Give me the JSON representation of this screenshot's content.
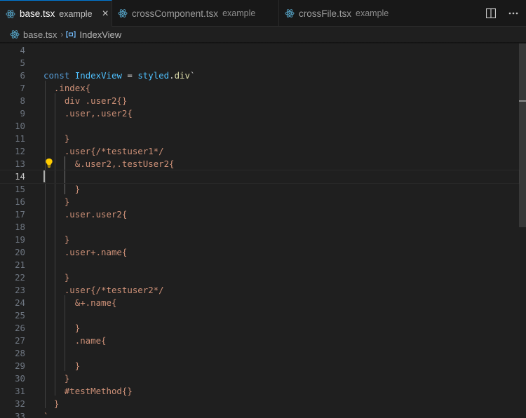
{
  "tabs": [
    {
      "label": "base.tsx",
      "description": "example",
      "active": true
    },
    {
      "label": "crossComponent.tsx",
      "description": "example",
      "active": false
    },
    {
      "label": "crossFile.tsx",
      "description": "example",
      "active": false
    }
  ],
  "breadcrumb": {
    "file": "base.tsx",
    "symbol": "IndexView"
  },
  "colors": {
    "accent": "#0078d4",
    "react_icon": "#519aba",
    "string": "#ce9178",
    "keyword": "#569cd6",
    "variable": "#4fc1ff",
    "bulb": "#ffcc00"
  },
  "editor": {
    "current_line": 14,
    "lines": [
      {
        "num": "4",
        "text": ""
      },
      {
        "num": "5",
        "text": ""
      },
      {
        "num": "6",
        "text": ""
      },
      {
        "num": "7",
        "text": "  .index{"
      },
      {
        "num": "8",
        "text": "    div .user2{}"
      },
      {
        "num": "9",
        "text": "    .user,.user2{"
      },
      {
        "num": "10",
        "text": ""
      },
      {
        "num": "11",
        "text": "    }"
      },
      {
        "num": "12",
        "text": "    .user{/*testuser1*/"
      },
      {
        "num": "13",
        "text": "      &.user2,.testUser2{"
      },
      {
        "num": "14",
        "text": ""
      },
      {
        "num": "15",
        "text": "      }"
      },
      {
        "num": "16",
        "text": "    }"
      },
      {
        "num": "17",
        "text": "    .user.user2{"
      },
      {
        "num": "18",
        "text": ""
      },
      {
        "num": "19",
        "text": "    }"
      },
      {
        "num": "20",
        "text": "    .user+.name{"
      },
      {
        "num": "21",
        "text": ""
      },
      {
        "num": "22",
        "text": "    }"
      },
      {
        "num": "23",
        "text": "    .user{/*testuser2*/"
      },
      {
        "num": "24",
        "text": "      &+.name{"
      },
      {
        "num": "25",
        "text": ""
      },
      {
        "num": "26",
        "text": "      }"
      },
      {
        "num": "27",
        "text": "      .name{"
      },
      {
        "num": "28",
        "text": ""
      },
      {
        "num": "29",
        "text": "      }"
      },
      {
        "num": "30",
        "text": "    }"
      },
      {
        "num": "31",
        "text": "    #testMethod{}"
      },
      {
        "num": "32",
        "text": "  }"
      },
      {
        "num": "33",
        "text": "`"
      }
    ],
    "line6": {
      "kw": "const",
      "name": "IndexView",
      "eq": "=",
      "obj": "styled",
      "dot": ".",
      "tag": "div",
      "tick": "`"
    }
  }
}
